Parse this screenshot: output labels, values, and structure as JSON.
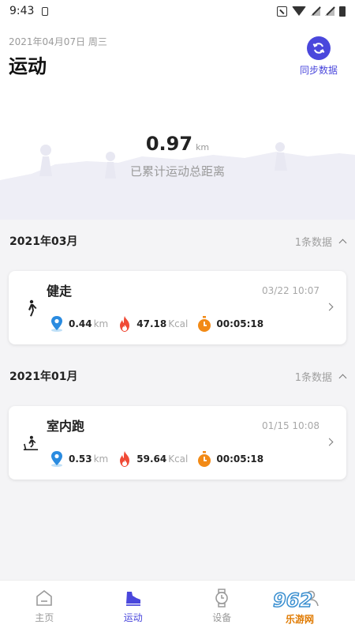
{
  "status_bar": {
    "time": "9:43"
  },
  "header": {
    "date": "2021年04月07日 周三",
    "title": "运动",
    "sync_label": "同步数据"
  },
  "summary": {
    "total_value": "0.97",
    "total_unit": "km",
    "caption": "已累计运动总距离"
  },
  "groups": [
    {
      "title": "2021年03月",
      "count": "1条数据",
      "records": [
        {
          "name": "健走",
          "icon": "walking-icon",
          "time": "03/22 10:07",
          "distance": "0.44",
          "distance_unit": "km",
          "calories": "47.18",
          "calories_unit": "Kcal",
          "duration": "00:05:18"
        }
      ]
    },
    {
      "title": "2021年01月",
      "count": "1条数据",
      "records": [
        {
          "name": "室内跑",
          "icon": "treadmill-icon",
          "time": "01/15 10:08",
          "distance": "0.53",
          "distance_unit": "km",
          "calories": "59.64",
          "calories_unit": "Kcal",
          "duration": "00:05:18"
        }
      ]
    }
  ],
  "tabs": [
    {
      "label": "主页",
      "icon": "home-icon",
      "active": false
    },
    {
      "label": "运动",
      "icon": "shoe-icon",
      "active": true
    },
    {
      "label": "设备",
      "icon": "watch-icon",
      "active": false
    }
  ],
  "watermark": {
    "brand": "962",
    "sub": "乐游网"
  },
  "colors": {
    "accent": "#4a47dc",
    "location": "#2a8be0",
    "fire": "#f04a36",
    "timer": "#f28a16"
  }
}
